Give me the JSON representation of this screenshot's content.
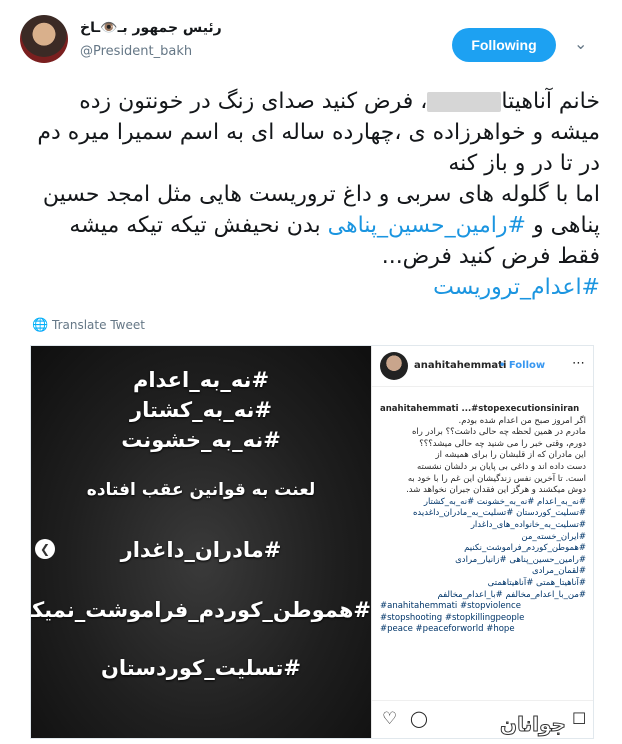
{
  "user": {
    "name": "رئیس جمهور بـ👁️ـاخ",
    "handle": "@President_bakh"
  },
  "follow_button": {
    "label": "Following",
    "color": "#1da1f2"
  },
  "tweet": {
    "line1": "خانم آناهیتا",
    "line1b": "، فرض کنید صدای زنگ در خونتون زده",
    "line2": "میشه و خواهرزاده ی ،چهارده ساله ای به اسم سمیرا میره دم",
    "line3": "در تا در و باز کنه",
    "line4": "اما با گلوله های سربی و داغ تروریست هایی مثل امجد حسین",
    "line5_pre": "پناهی و ",
    "line5_tag": "#رامین_حسین_پناهی",
    "line5_post": "  بدن نحیفش تیکه تیکه میشه",
    "line6": "فقط فرض کنید فرض...",
    "final_tag": "#اعدام_تروریست",
    "hashtag_color": "#1b95e0"
  },
  "translate": {
    "icon": "globe-icon",
    "label": "Translate Tweet"
  },
  "poster": {
    "lines": [
      "#نه_به_اعدام",
      "#نه_به_کشتار",
      "#نه_به_خشونت",
      "لعنت به قوانین عقب افتاده",
      "#مادران_داغدار",
      "#هموطن_کوردم_فراموشت_نمیکنیم",
      "#تسلیت_کوردستان"
    ]
  },
  "instagram": {
    "username": "anahitahemmati",
    "follow": "Follow",
    "caption_head": "anahitahemmati ...#stopexecutionsiniran",
    "caption_lines": [
      "اگر امروز صبح من اعدام شده بودم.",
      "مادرم در همین لحظه چه حالی داشت؟؟ برادر راه",
      "دورم، وقتی خبر را می شنید چه حالی میشد؟؟؟",
      "این مادران که از قلبشان را برای همیشه از",
      "دست داده اند و داغی بی پایان بر دلشان نشسته",
      "است. تا آخرین نفس زندگیشان این غم را با خود به",
      "دوش میکشند و هرگز این فقدان جبران نخواهد شد.",
      "#نه_به_اعدام #نه_به_خشونت #نه_به_کشتار",
      "#تسلیت_کوردستان #تسلیت_به_مادران_داغدیده",
      "#تسلیت_به_خانواده_های_داغدار",
      "#ایران_خسته_من",
      "#هموطن_کوردم_فراموشت_نکنیم",
      "#رامین_حسین_پناهی #زانیار_مرادی",
      "#لقمان_مرادی",
      "#آناهیتا_همتی #آناهیتاهمتی",
      "#من_با_اعدام_مخالفم #با_اعدام_مخالفم"
    ],
    "caption_tail": [
      "#anahitahemmati #stopviolence",
      "#stopshooting #stopkillingpeople",
      "#peace #peaceforworld #hope"
    ]
  },
  "watermark": "جوانان"
}
